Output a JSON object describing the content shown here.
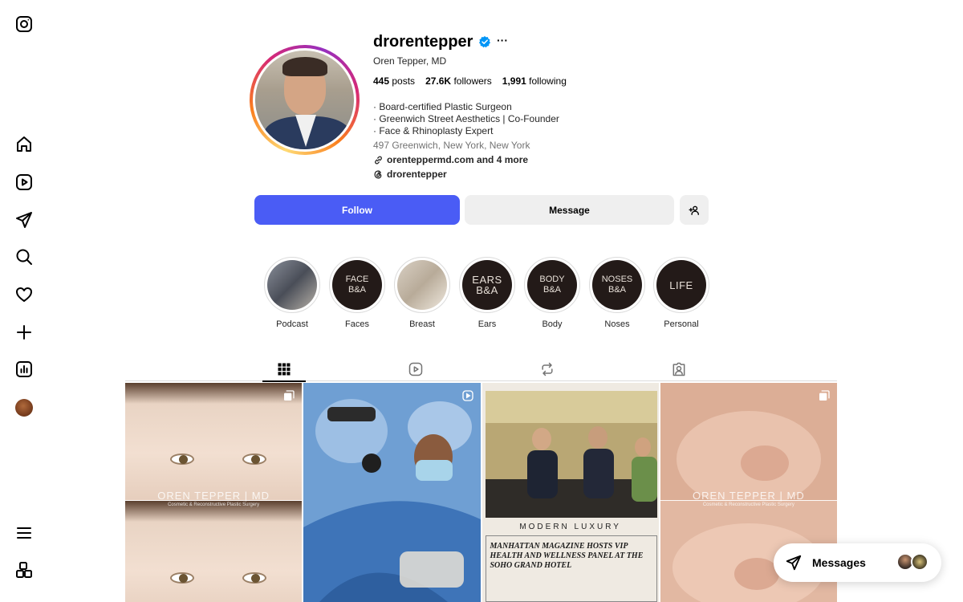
{
  "nav": {
    "items": [
      "instagram-logo-icon",
      "home-icon",
      "reels-icon",
      "direct-icon",
      "search-icon",
      "notifications-icon",
      "create-icon",
      "dashboard-icon",
      "profile-avatar",
      "menu-icon",
      "more-apps-icon"
    ]
  },
  "profile": {
    "username": "drorentepper",
    "full_name": "Oren Tepper, MD",
    "posts_count": "445",
    "posts_label": "posts",
    "followers_count": "27.6K",
    "followers_label": "followers",
    "following_count": "1,991",
    "following_label": "following",
    "bio_lines": [
      "· Board-certified Plastic Surgeon",
      "· Greenwich Street Aesthetics | Co-Founder",
      "· Face & Rhinoplasty Expert"
    ],
    "location": "497 Greenwich, New York, New York",
    "link_text": "orenteppermd.com and 4 more",
    "threads_handle": "drorentepper",
    "more_label": "···"
  },
  "actions": {
    "follow_label": "Follow",
    "message_label": "Message"
  },
  "highlights": [
    {
      "label": "Podcast",
      "text": ""
    },
    {
      "label": "Faces",
      "text_1": "FACE",
      "text_2": "B&A"
    },
    {
      "label": "Breast",
      "text": ""
    },
    {
      "label": "Ears",
      "text_1": "EARS",
      "text_2": "B&A"
    },
    {
      "label": "Body",
      "text_1": "BODY",
      "text_2": "B&A"
    },
    {
      "label": "Noses",
      "text_1": "NOSES",
      "text_2": "B&A"
    },
    {
      "label": "Personal",
      "text_1": "LIFE"
    }
  ],
  "tabs": [
    "posts-grid-icon",
    "reels-tab-icon",
    "reposts-tab-icon",
    "tagged-tab-icon"
  ],
  "posts": {
    "watermark_1": "OREN TEPPER | MD",
    "watermark_sub_1": "Cosmetic & Reconstructive Plastic Surgery",
    "watermark_4": "OREN TEPPER | MD",
    "watermark_sub_4": "Cosmetic & Reconstructive Plastic Surgery",
    "post3_brand": "MODERN LUXURY",
    "post3_headline": "MANHATTAN MAGAZINE HOSTS VIP HEALTH AND WELLNESS PANEL AT THE SOHO GRAND HOTEL"
  },
  "messages": {
    "label": "Messages"
  },
  "colors": {
    "follow_button": "#4a5cf5",
    "secondary_button": "#efefef",
    "verified_badge": "#0095f6",
    "link_text": "#00376b"
  }
}
